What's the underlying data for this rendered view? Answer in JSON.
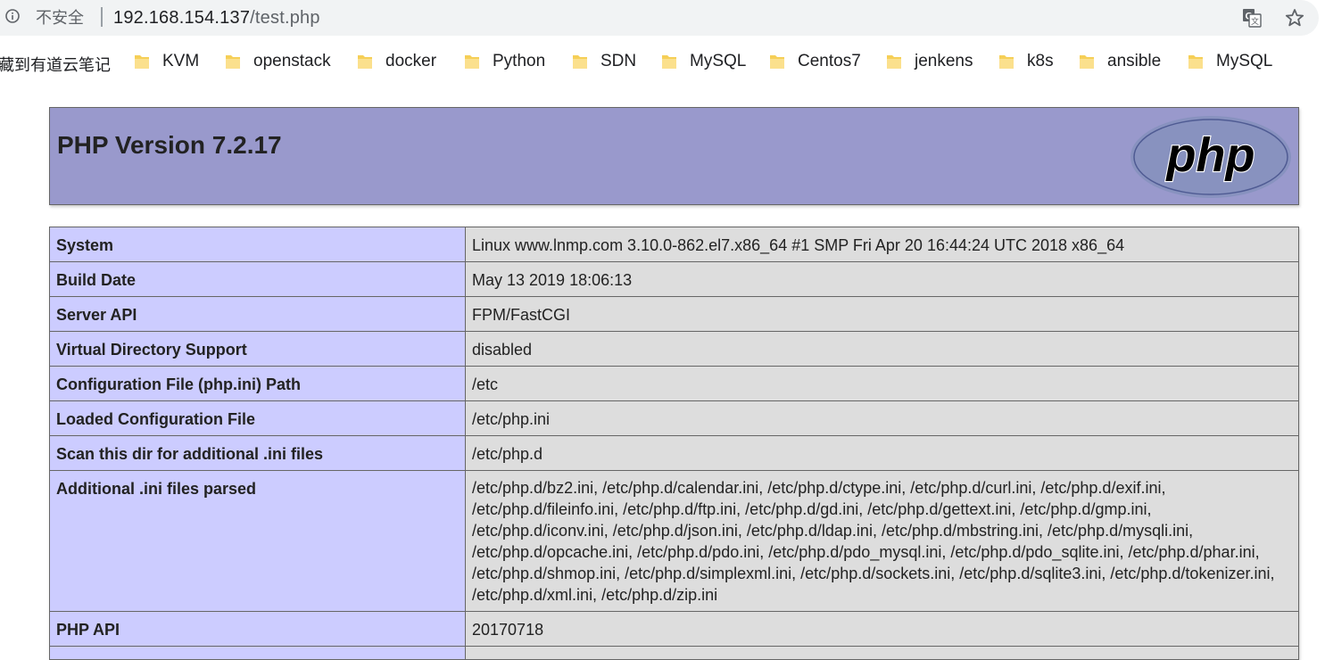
{
  "browser": {
    "security_label": "不安全",
    "url_host": "192.168.154.137",
    "url_path": "/test.php"
  },
  "bookmarks": {
    "first": "藏到有道云笔记",
    "folders": [
      "KVM",
      "openstack",
      "docker",
      "Python",
      "SDN",
      "MySQL",
      "Centos7",
      "jenkens",
      "k8s",
      "ansible",
      "MySQL"
    ],
    "folder_color": "#f6cf57"
  },
  "phpinfo": {
    "title": "PHP Version 7.2.17",
    "logo_text": "php",
    "rows": [
      {
        "key": "System",
        "value": "Linux www.lnmp.com 3.10.0-862.el7.x86_64 #1 SMP Fri Apr 20 16:44:24 UTC 2018 x86_64"
      },
      {
        "key": "Build Date",
        "value": "May 13 2019 18:06:13"
      },
      {
        "key": "Server API",
        "value": "FPM/FastCGI"
      },
      {
        "key": "Virtual Directory Support",
        "value": "disabled"
      },
      {
        "key": "Configuration File (php.ini) Path",
        "value": "/etc"
      },
      {
        "key": "Loaded Configuration File",
        "value": "/etc/php.ini"
      },
      {
        "key": "Scan this dir for additional .ini files",
        "value": "/etc/php.d"
      },
      {
        "key": "Additional .ini files parsed",
        "value": "/etc/php.d/bz2.ini, /etc/php.d/calendar.ini, /etc/php.d/ctype.ini, /etc/php.d/curl.ini, /etc/php.d/exif.ini, /etc/php.d/fileinfo.ini, /etc/php.d/ftp.ini, /etc/php.d/gd.ini, /etc/php.d/gettext.ini, /etc/php.d/gmp.ini, /etc/php.d/iconv.ini, /etc/php.d/json.ini, /etc/php.d/ldap.ini, /etc/php.d/mbstring.ini, /etc/php.d/mysqli.ini, /etc/php.d/opcache.ini, /etc/php.d/pdo.ini, /etc/php.d/pdo_mysql.ini, /etc/php.d/pdo_sqlite.ini, /etc/php.d/phar.ini, /etc/php.d/shmop.ini, /etc/php.d/simplexml.ini, /etc/php.d/sockets.ini, /etc/php.d/sqlite3.ini, /etc/php.d/tokenizer.ini, /etc/php.d/xml.ini, /etc/php.d/zip.ini"
      },
      {
        "key": "PHP API",
        "value": "20170718"
      },
      {
        "key": "",
        "value": ""
      }
    ]
  },
  "colors": {
    "header_bg": "#9999cc",
    "key_cell_bg": "#ccccff",
    "value_cell_bg": "#dddddd",
    "logo_bg": "#8892bf"
  }
}
